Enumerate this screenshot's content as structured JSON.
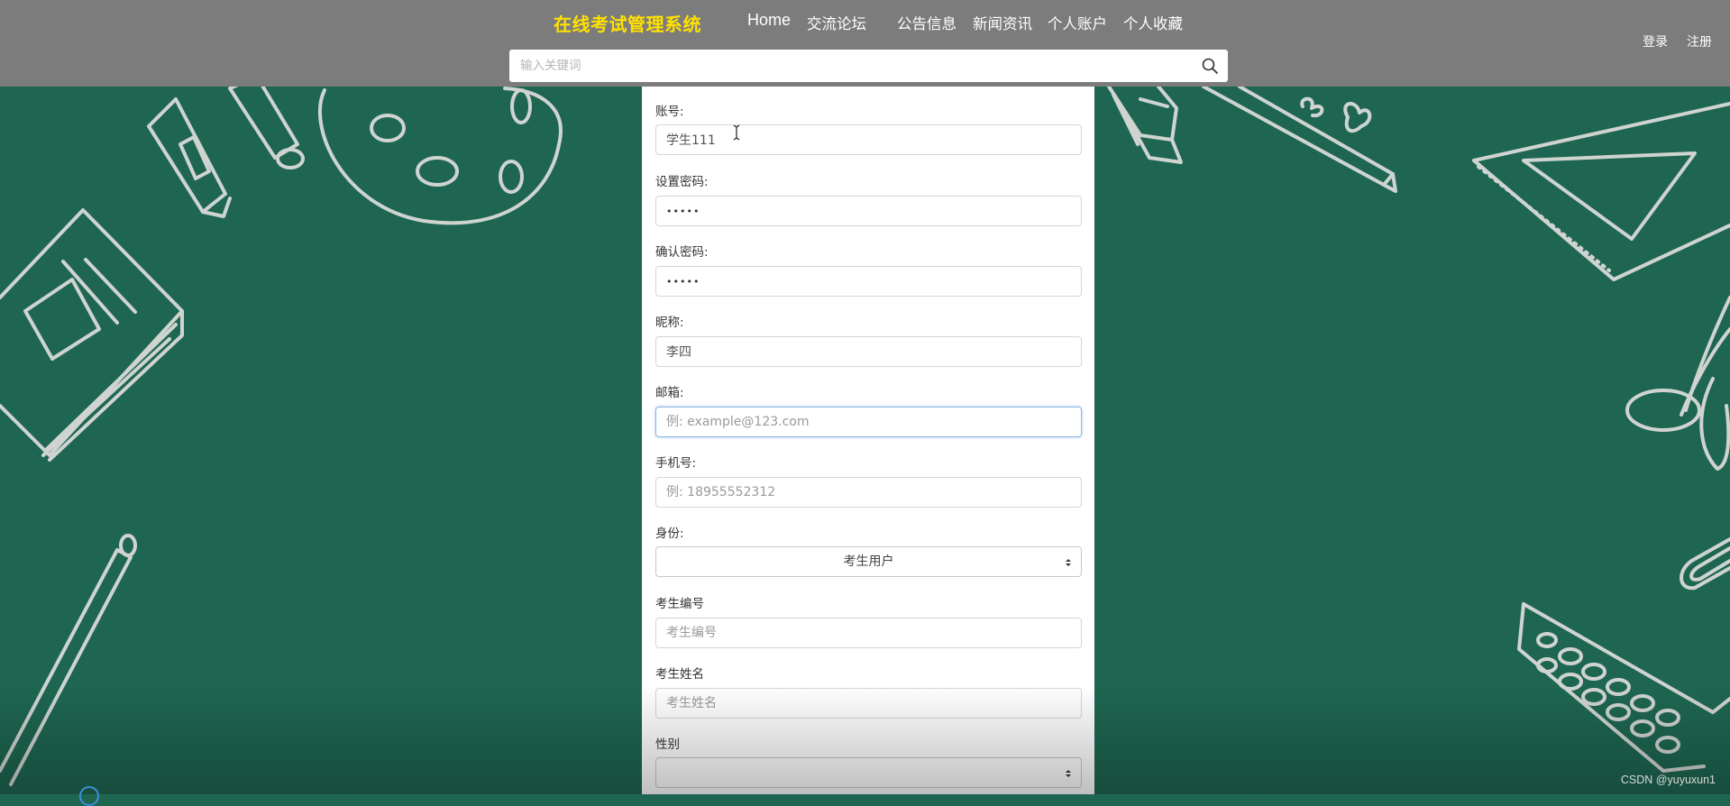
{
  "header": {
    "brand": "在线考试管理系统",
    "nav": [
      "Home",
      "交流论坛",
      "公告信息",
      "新闻资讯",
      "个人账户",
      "个人收藏"
    ],
    "login": "登录",
    "register": "注册",
    "search_placeholder": "输入关键词"
  },
  "form": {
    "account_label": "账号:",
    "account_value": "学生111",
    "password_label": "设置密码:",
    "password_value": "•••••",
    "confirm_label": "确认密码:",
    "confirm_value": "•••••",
    "nickname_label": "昵称:",
    "nickname_value": "李四",
    "email_label": "邮箱:",
    "email_placeholder": "例: example@123.com",
    "phone_label": "手机号:",
    "phone_placeholder": "例: 18955552312",
    "identity_label": "身份:",
    "identity_value": "考生用户",
    "student_no_label": "考生编号",
    "student_no_placeholder": "考生编号",
    "student_name_label": "考生姓名",
    "student_name_placeholder": "考生姓名",
    "gender_label": "性别",
    "gender_value": ""
  },
  "watermark": "CSDN @yuyuxun1",
  "colors": {
    "header_bg": "#7c7c7c",
    "brand": "#ffe100",
    "chalkboard": "#1e6651",
    "chalk": "#d2d6d3"
  }
}
